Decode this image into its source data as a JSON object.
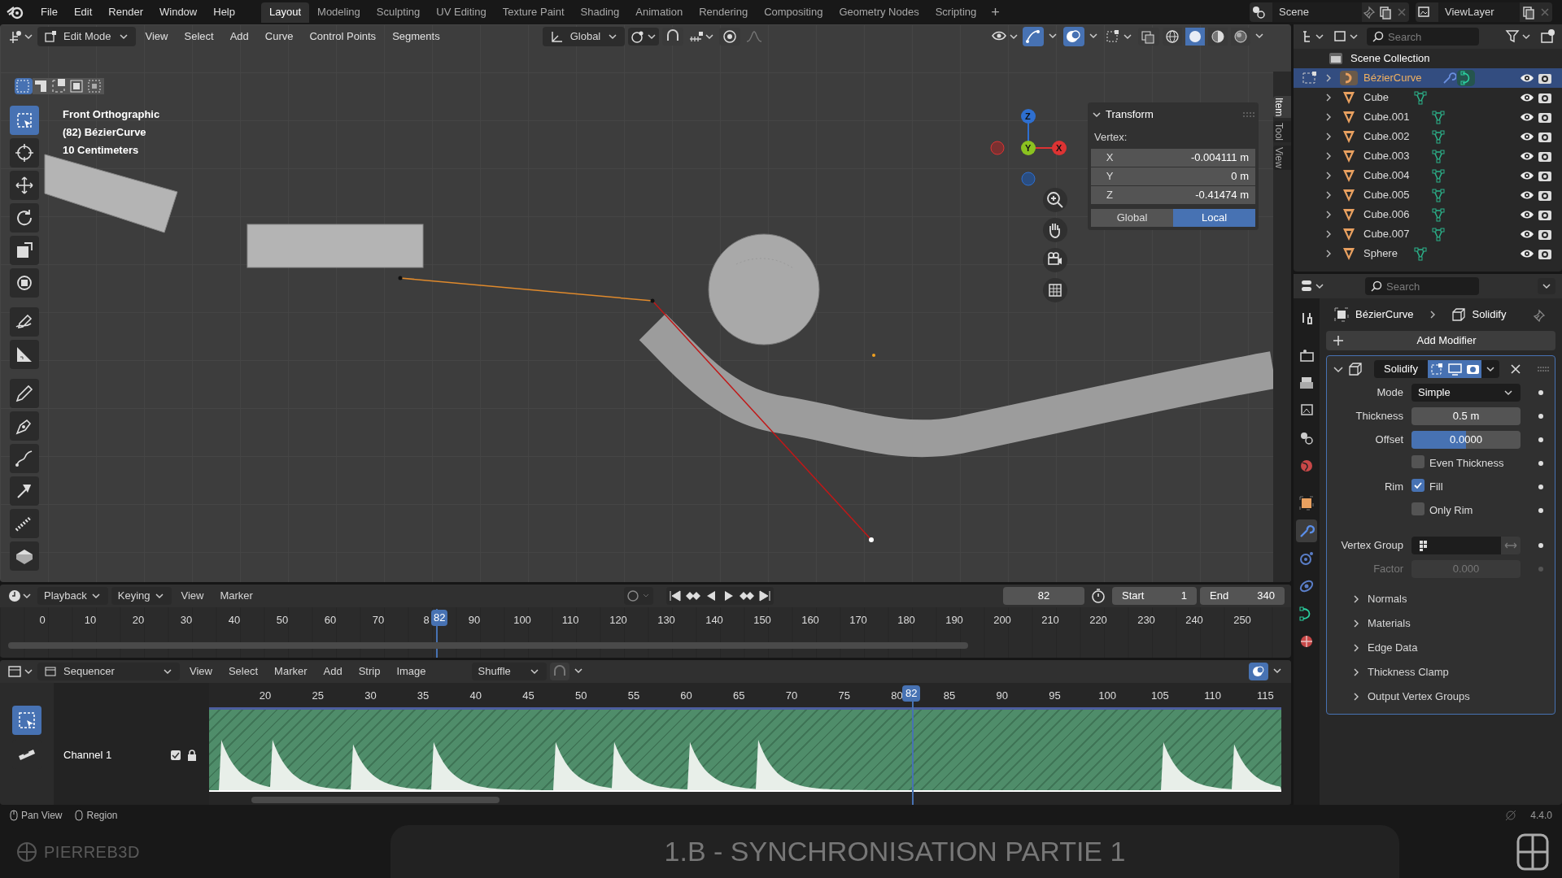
{
  "menu_bar": {
    "menus": [
      "File",
      "Edit",
      "Render",
      "Window",
      "Help"
    ],
    "workspaces": [
      {
        "label": "Layout",
        "selected": true
      },
      {
        "label": "Modeling",
        "selected": false
      },
      {
        "label": "Sculpting",
        "selected": false
      },
      {
        "label": "UV Editing",
        "selected": false
      },
      {
        "label": "Texture Paint",
        "selected": false
      },
      {
        "label": "Shading",
        "selected": false
      },
      {
        "label": "Animation",
        "selected": false
      },
      {
        "label": "Rendering",
        "selected": false
      },
      {
        "label": "Compositing",
        "selected": false
      },
      {
        "label": "Geometry Nodes",
        "selected": false
      },
      {
        "label": "Scripting",
        "selected": false
      }
    ],
    "add_tab": "+",
    "scene": "Scene",
    "view_layer": "ViewLayer"
  },
  "viewport": {
    "mode": "Edit Mode",
    "menus": [
      "View",
      "Select",
      "Add",
      "Curve",
      "Control Points",
      "Segments"
    ],
    "orientation": "Global",
    "select_modes": [
      {
        "selected": true
      },
      {
        "selected": false
      },
      {
        "selected": false
      },
      {
        "selected": false
      },
      {
        "selected": false
      }
    ],
    "overlay_text": [
      "Front Orthographic",
      "(82) BézierCurve",
      "10 Centimeters"
    ],
    "tools": [
      {
        "kind": "select",
        "selected": true
      },
      {
        "kind": "cursor",
        "selected": false
      },
      {
        "kind": "move",
        "selected": false
      },
      {
        "kind": "rotate",
        "selected": false
      },
      {
        "kind": "scale",
        "selected": false
      },
      {
        "kind": "transform",
        "selected": false
      },
      {
        "kind": "annotate",
        "selected": false
      },
      {
        "kind": "measure",
        "selected": false
      },
      {
        "kind": "draw",
        "selected": false
      },
      {
        "kind": "pen",
        "selected": false
      },
      {
        "kind": "curve",
        "selected": false
      },
      {
        "kind": "tilt",
        "selected": false
      },
      {
        "kind": "radius",
        "selected": false
      },
      {
        "kind": "extrude",
        "selected": false
      }
    ],
    "gizmo_axes": [
      "Z",
      "Y",
      "X"
    ],
    "transform": {
      "title": "Transform",
      "label": "Vertex:",
      "fields": [
        {
          "axis": "X",
          "value": "-0.004111 m"
        },
        {
          "axis": "Y",
          "value": "0 m"
        },
        {
          "axis": "Z",
          "value": "-0.41474 m"
        }
      ],
      "spaces": [
        {
          "label": "Global",
          "selected": false
        },
        {
          "label": "Local",
          "selected": true
        }
      ]
    },
    "side_tabs": [
      {
        "label": "Item",
        "selected": true
      },
      {
        "label": "Tool",
        "selected": false
      },
      {
        "label": "View",
        "selected": false
      }
    ]
  },
  "outliner": {
    "search_placeholder": "Search",
    "collection": "Scene Collection",
    "items": [
      {
        "name": "BézierCurve",
        "kind": "curve",
        "selected": true
      },
      {
        "name": "Cube",
        "kind": "mesh",
        "selected": false
      },
      {
        "name": "Cube.001",
        "kind": "mesh",
        "selected": false
      },
      {
        "name": "Cube.002",
        "kind": "mesh",
        "selected": false
      },
      {
        "name": "Cube.003",
        "kind": "mesh",
        "selected": false
      },
      {
        "name": "Cube.004",
        "kind": "mesh",
        "selected": false
      },
      {
        "name": "Cube.005",
        "kind": "mesh",
        "selected": false
      },
      {
        "name": "Cube.006",
        "kind": "mesh",
        "selected": false
      },
      {
        "name": "Cube.007",
        "kind": "mesh",
        "selected": false
      },
      {
        "name": "Sphere",
        "kind": "mesh",
        "selected": false
      }
    ]
  },
  "properties": {
    "search_placeholder": "Search",
    "tabs": [
      {
        "kind": "tool",
        "selected": false
      },
      {
        "kind": "render",
        "selected": false
      },
      {
        "kind": "output",
        "selected": false
      },
      {
        "kind": "view_layer",
        "selected": false
      },
      {
        "kind": "scene",
        "selected": false
      },
      {
        "kind": "world",
        "selected": false
      },
      {
        "kind": "object",
        "selected": false
      },
      {
        "kind": "modifiers",
        "selected": true
      },
      {
        "kind": "particles",
        "selected": false
      },
      {
        "kind": "physics",
        "selected": false
      },
      {
        "kind": "data",
        "selected": false
      },
      {
        "kind": "material",
        "selected": false
      }
    ],
    "breadcrumb": [
      "BézierCurve",
      "Solidify"
    ],
    "add_modifier": "Add Modifier",
    "modifier": {
      "name": "Solidify",
      "expanded": true,
      "toggles": [
        {
          "kind": "edit_mode",
          "on": true
        },
        {
          "kind": "viewport",
          "on": true
        },
        {
          "kind": "render",
          "on": true
        }
      ],
      "rows": [
        {
          "kind": "dropdown",
          "label": "Mode",
          "value": "Simple"
        },
        {
          "kind": "number",
          "label": "Thickness",
          "value": "0.5 m"
        },
        {
          "kind": "slider",
          "label": "Offset",
          "value": "0.0000",
          "level": 0.5
        },
        {
          "kind": "checkbox",
          "text": "Even Thickness",
          "checked": false
        },
        {
          "kind": "checkbox",
          "label": "Rim",
          "text": "Fill",
          "checked": true
        },
        {
          "kind": "checkbox",
          "text": "Only Rim",
          "checked": false
        },
        {
          "kind": "vertex_group",
          "label": "Vertex Group"
        },
        {
          "kind": "number",
          "label": "Factor",
          "value": "0.000",
          "disabled": true
        }
      ],
      "subpanels": [
        {
          "label": "Normals",
          "expanded": false
        },
        {
          "label": "Materials",
          "expanded": false
        },
        {
          "label": "Edge Data",
          "expanded": false
        },
        {
          "label": "Thickness Clamp",
          "expanded": false
        },
        {
          "label": "Output Vertex Groups",
          "expanded": false
        }
      ]
    }
  },
  "timeline": {
    "menus": [
      "Playback",
      "Keying",
      "View",
      "Marker"
    ],
    "current_frame": "82",
    "start_label": "Start",
    "start": "1",
    "end_label": "End",
    "end": "340",
    "ticks": [
      "0",
      "10",
      "20",
      "30",
      "40",
      "50",
      "60",
      "70",
      "8",
      "90",
      "100",
      "110",
      "120",
      "130",
      "140",
      "150",
      "160",
      "170",
      "180",
      "190",
      "200",
      "210",
      "220",
      "230",
      "240",
      "250"
    ],
    "playhead": "82"
  },
  "sequencer": {
    "editor": "Sequencer",
    "menus": [
      "View",
      "Select",
      "Marker",
      "Add",
      "Strip",
      "Image"
    ],
    "overlap": "Shuffle",
    "ticks": [
      "20",
      "25",
      "30",
      "35",
      "40",
      "45",
      "50",
      "55",
      "60",
      "65",
      "70",
      "75",
      "80",
      "85",
      "90",
      "95",
      "100",
      "105",
      "110",
      "115"
    ],
    "playhead": "82",
    "channel": "Channel 1"
  },
  "status_bar": {
    "items": [
      "Pan View",
      "Region"
    ],
    "version": "4.4.0"
  },
  "video_caption": {
    "brand": "PIERREB3D",
    "title": "1.B - SYNCHRONISATION PARTIE 1"
  }
}
